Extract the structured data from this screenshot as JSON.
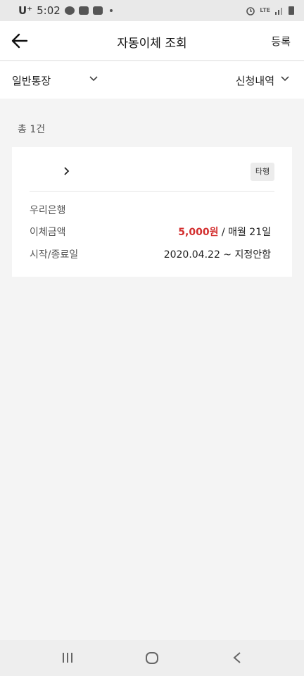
{
  "status_bar": {
    "carrier": "U⁺",
    "time": "5:02",
    "network": "LTE"
  },
  "header": {
    "title": "자동이체 조회",
    "register_label": "등록"
  },
  "filter": {
    "account_label": "일반통장",
    "history_label": "신청내역"
  },
  "summary": {
    "count_text": "총 1건"
  },
  "transfer": {
    "badge": "타행",
    "bank": "우리은행",
    "amount_label": "이체금액",
    "amount": "5,000원",
    "schedule": " / 매월 21일",
    "period_label": "시작/종료일",
    "period_value": "2020.04.22 ~ 지정안함"
  },
  "colors": {
    "amount": "#d32f2f",
    "background": "#f4f4f4"
  }
}
